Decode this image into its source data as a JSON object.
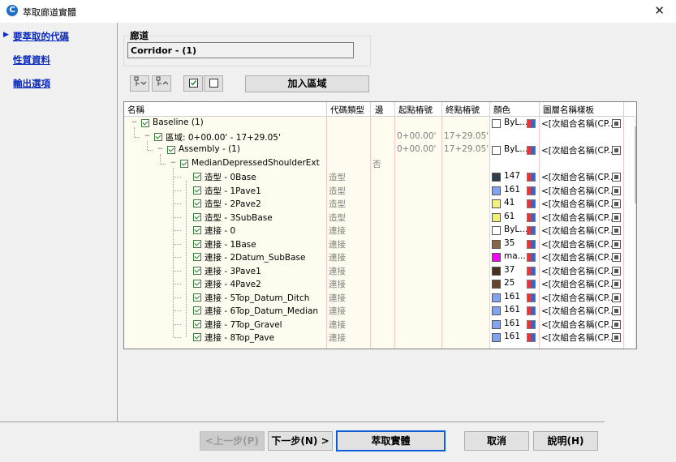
{
  "window": {
    "title": "萃取廊道實體",
    "close_glyph": "✕",
    "app_icon_letter": "C"
  },
  "nav": {
    "items": [
      {
        "label": "要萃取的代碼",
        "selected": true
      },
      {
        "label": "性質資料",
        "selected": false
      },
      {
        "label": "輸出選項",
        "selected": false
      }
    ]
  },
  "corridor": {
    "label": "廊道",
    "value": "Corridor - (1)"
  },
  "toolbar": {
    "expand_all_icon": "expand-all-icon",
    "collapse_all_icon": "collapse-all-icon",
    "check_all_icon": "check-all-icon",
    "uncheck_all_icon": "uncheck-all-icon",
    "add_region_label": "加入區域"
  },
  "grid": {
    "headers": [
      "名稱",
      "代碼類型",
      "邊",
      "起點樁號",
      "終點樁號",
      "顏色",
      "圖層名稱樣板"
    ],
    "rows": [
      {
        "name": "Baseline (1)",
        "type": "",
        "side": "",
        "start": "",
        "end": "",
        "color": "ByL...",
        "swatch": "#ffffff",
        "layer": "<[次組合名稱(CP...",
        "level": 0,
        "expander": "−"
      },
      {
        "name": "區域: 0+00.00' - 17+29.05'",
        "type": "",
        "side": "",
        "start": "0+00.00'",
        "end": "17+29.05'",
        "color": "",
        "swatch": "",
        "layer": "",
        "level": 1,
        "expander": "−"
      },
      {
        "name": "Assembly - (1)",
        "type": "",
        "side": "",
        "start": "0+00.00'",
        "end": "17+29.05'",
        "color": "ByL...",
        "swatch": "#ffffff",
        "layer": "<[次組合名稱(CP...",
        "level": 2,
        "expander": "−"
      },
      {
        "name": "MedianDepressedShoulderExt",
        "type": "",
        "side": "否",
        "start": "",
        "end": "",
        "color": "",
        "swatch": "",
        "layer": "",
        "level": 3,
        "expander": "−"
      },
      {
        "name": "造型 - 0Base",
        "type": "造型",
        "side": "",
        "start": "",
        "end": "",
        "color": "147",
        "swatch": "#2e3e4a",
        "layer": "<[次組合名稱(CP...",
        "level": 4,
        "expander": ""
      },
      {
        "name": "造型 - 1Pave1",
        "type": "造型",
        "side": "",
        "start": "",
        "end": "",
        "color": "161",
        "swatch": "#7fa3f5",
        "layer": "<[次組合名稱(CP...",
        "level": 4,
        "expander": ""
      },
      {
        "name": "造型 - 2Pave2",
        "type": "造型",
        "side": "",
        "start": "",
        "end": "",
        "color": "41",
        "swatch": "#f5f07a",
        "layer": "<[次組合名稱(CP...",
        "level": 4,
        "expander": ""
      },
      {
        "name": "造型 - 3SubBase",
        "type": "造型",
        "side": "",
        "start": "",
        "end": "",
        "color": "61",
        "swatch": "#eef070",
        "layer": "<[次組合名稱(CP...",
        "level": 4,
        "expander": ""
      },
      {
        "name": "連接 - 0",
        "type": "連接",
        "side": "",
        "start": "",
        "end": "",
        "color": "ByL...",
        "swatch": "#ffffff",
        "layer": "<[次組合名稱(CP...",
        "level": 4,
        "expander": ""
      },
      {
        "name": "連接 - 1Base",
        "type": "連接",
        "side": "",
        "start": "",
        "end": "",
        "color": "35",
        "swatch": "#8a6444",
        "layer": "<[次組合名稱(CP...",
        "level": 4,
        "expander": ""
      },
      {
        "name": "連接 - 2Datum_SubBase",
        "type": "連接",
        "side": "",
        "start": "",
        "end": "",
        "color": "ma...",
        "swatch": "#ff00ff",
        "layer": "<[次組合名稱(CP...",
        "level": 4,
        "expander": ""
      },
      {
        "name": "連接 - 3Pave1",
        "type": "連接",
        "side": "",
        "start": "",
        "end": "",
        "color": "37",
        "swatch": "#4a3020",
        "layer": "<[次組合名稱(CP...",
        "level": 4,
        "expander": ""
      },
      {
        "name": "連接 - 4Pave2",
        "type": "連接",
        "side": "",
        "start": "",
        "end": "",
        "color": "25",
        "swatch": "#6a4228",
        "layer": "<[次組合名稱(CP...",
        "level": 4,
        "expander": ""
      },
      {
        "name": "連接 - 5Top_Datum_Ditch",
        "type": "連接",
        "side": "",
        "start": "",
        "end": "",
        "color": "161",
        "swatch": "#7fa3f5",
        "layer": "<[次組合名稱(CP...",
        "level": 4,
        "expander": ""
      },
      {
        "name": "連接 - 6Top_Datum_Median",
        "type": "連接",
        "side": "",
        "start": "",
        "end": "",
        "color": "161",
        "swatch": "#7fa3f5",
        "layer": "<[次組合名稱(CP...",
        "level": 4,
        "expander": ""
      },
      {
        "name": "連接 - 7Top_Gravel",
        "type": "連接",
        "side": "",
        "start": "",
        "end": "",
        "color": "161",
        "swatch": "#7fa3f5",
        "layer": "<[次組合名稱(CP...",
        "level": 4,
        "expander": ""
      },
      {
        "name": "連接 - 8Top_Pave",
        "type": "連接",
        "side": "",
        "start": "",
        "end": "",
        "color": "161",
        "swatch": "#7fa3f5",
        "layer": "<[次組合名稱(CP...",
        "level": 4,
        "expander": ""
      }
    ]
  },
  "buttons": {
    "back": "<上一步(P)",
    "next": "下一步(N) >",
    "extract": "萃取實體",
    "cancel": "取消",
    "help": "說明(H)"
  },
  "colors": {
    "link": "#0a2bbf",
    "column_tint": "#fdfcee",
    "focus_border": "#0a5fd6"
  }
}
